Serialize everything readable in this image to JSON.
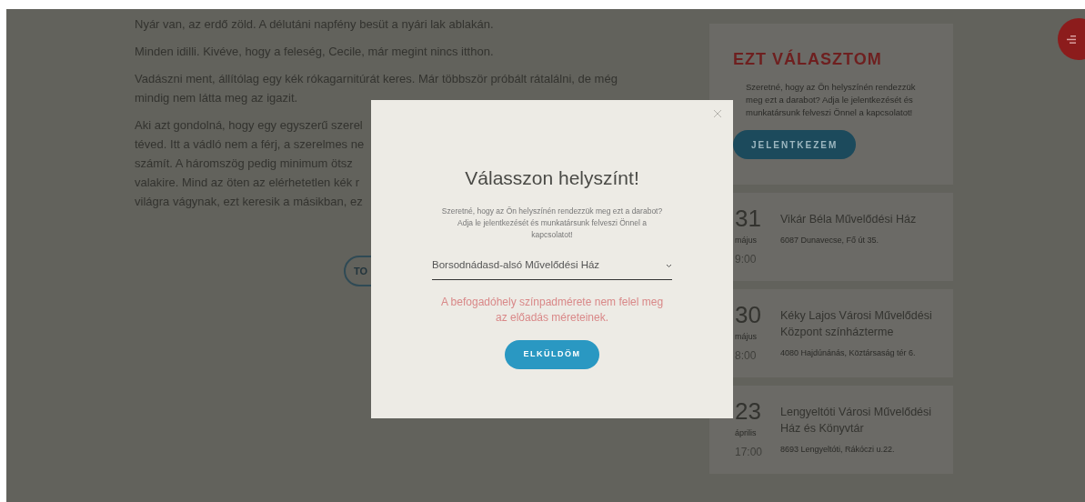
{
  "article": {
    "paragraphs": [
      {
        "lines": [
          "Nyár van, az erdő zöld. A délutáni napfény besüt a nyári lak ablakán."
        ]
      },
      {
        "lines": [
          "Minden idilli. Kivéve, hogy a feleség, Cecile, már megint nincs itthon."
        ]
      },
      {
        "lines": [
          "Vadászni ment, állítólag egy kék rókagarnitúrát keres. Már többször próbált rátalálni, de még",
          "mindig nem látta meg az igazit."
        ]
      },
      {
        "lines": [
          "Aki azt gondolná, hogy egy egyszerű szerel",
          "téved. Itt a vádló nem a férj, a szerelmes ne",
          "számít. A háromszög pedig minimum ötsz",
          "valakire. Mind az öten az elérhetetlen kék r",
          "világra vágynak, ezt keresik a másikban, ez"
        ]
      }
    ],
    "more_button": "TO"
  },
  "offer_card": {
    "title": "EZT VÁLASZTOM",
    "text": "Szeretné, hogy az Ön helyszínén rendezzük meg ezt a darabot? Adja le jelentkezését és munkatársunk felveszi Önnel a kapcsolatot!",
    "button": "JELENTKEZEM"
  },
  "events": [
    {
      "day": "31",
      "month": "május",
      "time": "9:00",
      "venue": "Vikár Béla Művelődési Ház",
      "address": "6087 Dunavecse, Fő út 35."
    },
    {
      "day": "30",
      "month": "május",
      "time": "8:00",
      "venue": "Kéky Lajos Városi Művelődési Központ színházterme",
      "address": "4080 Hajdúnánás, Köztársaság tér 6."
    },
    {
      "day": "23",
      "month": "április",
      "time": "17:00",
      "venue": "Lengyeltóti Városi Művelődési Ház és Könyvtár",
      "address": "8693 Lengyeltóti, Rákóczi u.22."
    }
  ],
  "modal": {
    "title": "Válasszon helyszínt!",
    "text": "Szeretné, hogy az Ön helyszínén rendezzük meg ezt a darabot? Adja le jelentkezését és munkatársunk felveszi Önnel a kapcsolatot!",
    "select_value": "Borsodnádasd-alsó Művelődési Ház",
    "error": "A befogadóhely színpadmérete nem felel meg az előadás méreteinek.",
    "submit": "ELKÜLDÖM"
  }
}
